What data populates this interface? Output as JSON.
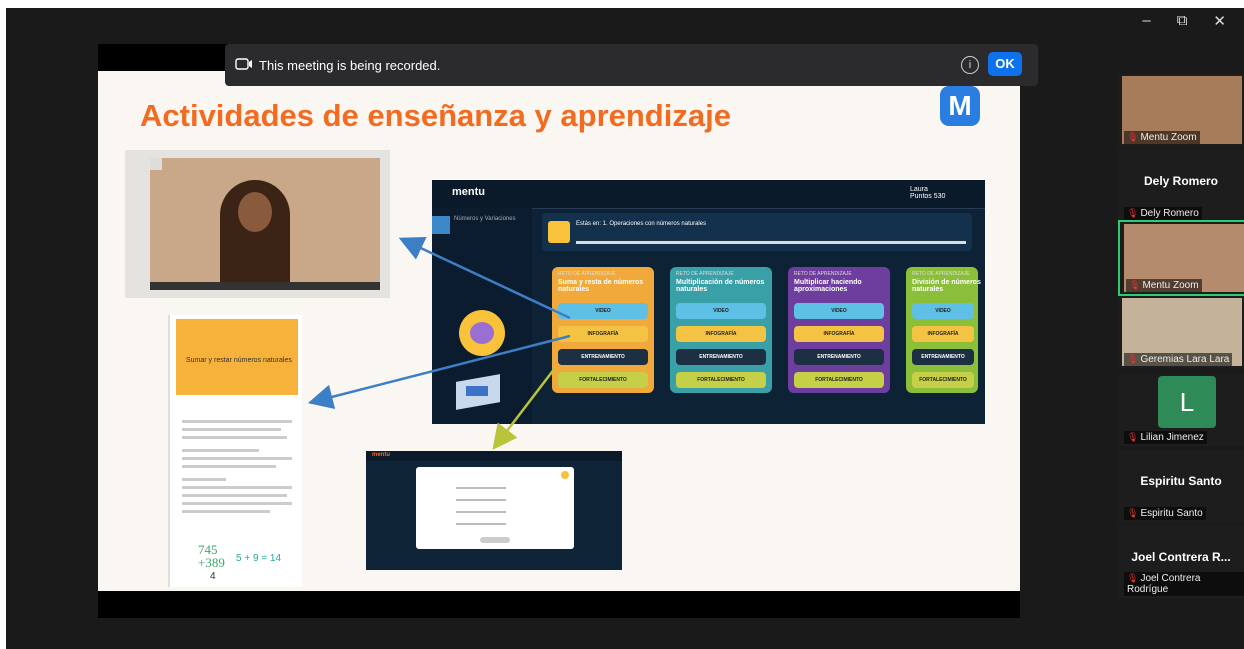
{
  "window_controls": {
    "minimize": "–",
    "restore": "⧉",
    "close": "✕"
  },
  "banner": {
    "text": "This meeting is being recorded.",
    "ok": "OK",
    "info": "i"
  },
  "slide": {
    "title": "Actividades de enseñanza y aprendizaje",
    "logo_letter": "M",
    "doc_title": "Sumar y restar números naturales",
    "doc_math": "745\n+389",
    "doc_math_rhs": "5 + 9 = 14",
    "doc_bottom": "4"
  },
  "app": {
    "brand": "mentu",
    "user": "Laura",
    "user_sub": "Puntos 530",
    "side_label": "Números y Variaciones",
    "unit_title": "Estás en: 1. Operaciones con números naturales",
    "cards": [
      {
        "tag": "RETO DE APRENDIZAJE",
        "title": "Suma y resta de números naturales",
        "color": "#f2a93b",
        "b1": "VIDEO",
        "b2": "INFOGRAFÍA",
        "b3": "ENTRENAMIENTO",
        "b4": "FORTALECIMIENTO"
      },
      {
        "tag": "RETO DE APRENDIZAJE",
        "title": "Multiplicación de números naturales",
        "color": "#3aa0a8",
        "b1": "VIDEO",
        "b2": "INFOGRAFÍA",
        "b3": "ENTRENAMIENTO",
        "b4": "FORTALECIMIENTO"
      },
      {
        "tag": "RETO DE APRENDIZAJE",
        "title": "Multiplicar haciendo aproximaciones",
        "color": "#6e3e9e",
        "b1": "VIDEO",
        "b2": "INFOGRAFÍA",
        "b3": "ENTRENAMIENTO",
        "b4": "FORTALECIMIENTO"
      },
      {
        "tag": "RETO DE APRENDIZAJE",
        "title": "División de números naturales",
        "color": "#8bbf3a",
        "b1": "VIDEO",
        "b2": "INFOGRAFÍA",
        "b3": "ENTRENAMIENTO",
        "b4": "FORTALECIMIENTO"
      }
    ]
  },
  "quiz": {
    "brand": "mentu"
  },
  "participants": [
    {
      "name": "Mentu Zoom",
      "type": "video",
      "color": "#a67c5b"
    },
    {
      "name": "Dely Romero",
      "big": "Dely Romero",
      "type": "name"
    },
    {
      "name": "Mentu Zoom",
      "type": "video",
      "color": "#b58b6e",
      "active": true
    },
    {
      "name": "Geremias Lara Lara",
      "type": "video",
      "color": "#c4b39a"
    },
    {
      "name": "Lilian Jimenez",
      "type": "avatar",
      "initial": "L"
    },
    {
      "name": "Espiritu Santo",
      "big": "Espiritu Santo",
      "type": "name"
    },
    {
      "name": "Joel Contrera Rodrígue",
      "big": "Joel Contrera R...",
      "type": "name"
    }
  ],
  "colors": {
    "title": "#f26b21",
    "ok": "#0e72ed",
    "active_border": "#2ecc71"
  }
}
